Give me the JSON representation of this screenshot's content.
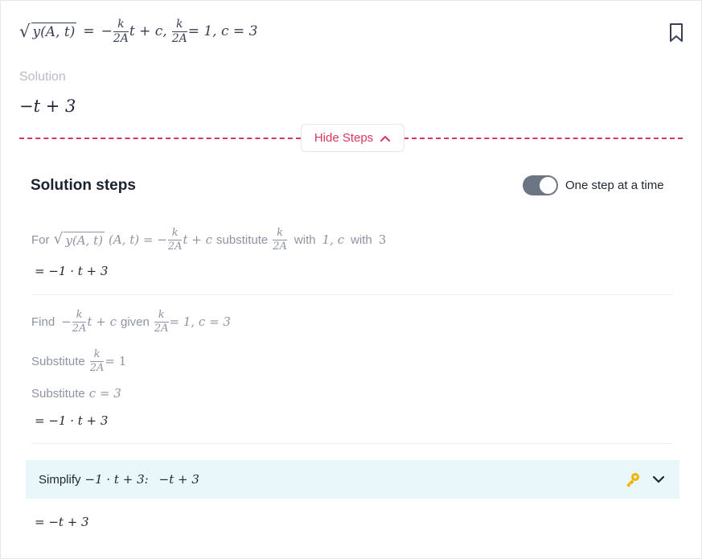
{
  "problem": {
    "sqrt_arg": "y(A, t)",
    "equals": "=",
    "minus": "−",
    "frac_num": "k",
    "frac_den": "2A",
    "after_frac": "t + c,",
    "cond_tail": "= 1, c = 3"
  },
  "solution": {
    "label": "Solution",
    "value": "−t + 3"
  },
  "hide_steps": {
    "label": "Hide Steps"
  },
  "steps": {
    "title": "Solution steps",
    "toggle_label": "One step at a time",
    "toggle_on": true,
    "step1": {
      "word_for": "For",
      "sqrt_arg": "y(A, t)",
      "expr_mid": "(A, t) = −",
      "frac_num": "k",
      "frac_den": "2A",
      "expr_tail": "t + c",
      "word_substitute": "substitute",
      "sub_frac_num": "k",
      "sub_frac_den": "2A",
      "word_with1": "with",
      "val1": "1, c",
      "word_with2": "with",
      "val2": "3",
      "result": "= −1 ·  t + 3"
    },
    "step2": {
      "word_find": "Find",
      "find_minus": "−",
      "find_frac_num": "k",
      "find_frac_den": "2A",
      "find_tail": "t + c",
      "word_given": "given",
      "given_frac_num": "k",
      "given_frac_den": "2A",
      "given_tail": "= 1, c = 3",
      "sub_a_word": "Substitute",
      "sub_a_frac_num": "k",
      "sub_a_frac_den": "2A",
      "sub_a_tail": "= 1",
      "sub_b_word": "Substitute",
      "sub_b_expr": "c = 3",
      "result": "= −1 ·  t + 3"
    },
    "simplify": {
      "word": "Simplify",
      "expr": "−1 ·  t + 3:",
      "answer": "−t + 3",
      "result": "= −t + 3"
    }
  },
  "colors": {
    "accent_red": "#d9365d",
    "highlight_bg": "#e9f7fb",
    "key_gold": "#f0b400",
    "toggle_bg": "#6b7583"
  }
}
